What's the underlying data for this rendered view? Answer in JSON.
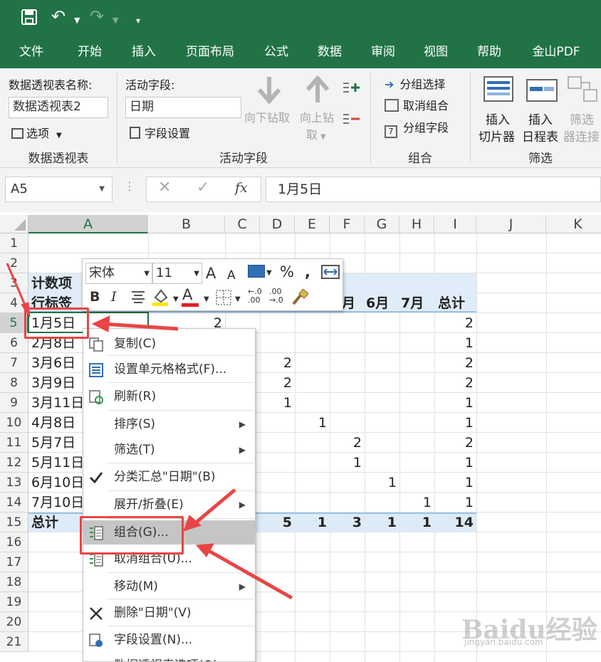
{
  "quick_access": {
    "undo_label": "↶",
    "redo_label": "↷"
  },
  "ribbon_tabs": [
    "文件",
    "开始",
    "插入",
    "页面布局",
    "公式",
    "数据",
    "审阅",
    "视图",
    "帮助",
    "金山PDF"
  ],
  "ribbon": {
    "pivot_name_label": "数据透视表名称:",
    "pivot_name_value": "数据透视表2",
    "options_label": "选项",
    "group1_title": "数据透视表",
    "active_field_label": "活动字段:",
    "active_field_value": "日期",
    "field_settings_label": "字段设置",
    "drill_down_label": "向下钻取",
    "drill_up_label1": "向上钻",
    "drill_up_label2": "取",
    "group2_title": "活动字段",
    "group_selection_label": "分组选择",
    "ungroup_label": "取消组合",
    "group_field_label": "分组字段",
    "group3_title": "组合",
    "insert_slicer_1": "插入",
    "insert_slicer_2": "切片器",
    "insert_timeline_1": "插入",
    "insert_timeline_2": "日程表",
    "filter_conn_1": "筛选",
    "filter_conn_2": "器连接",
    "group4_title": "筛选"
  },
  "formula_bar": {
    "name_box": "A5",
    "fx": "fx",
    "value": "1月5日"
  },
  "columns": [
    "A",
    "B",
    "C",
    "D",
    "E",
    "F",
    "G",
    "H",
    "I",
    "J",
    "K"
  ],
  "rows": [
    "1",
    "2",
    "3",
    "4",
    "5",
    "6",
    "7",
    "8",
    "9",
    "10",
    "11",
    "12",
    "13",
    "14",
    "15",
    "16",
    "17",
    "18",
    "19",
    "20",
    "21"
  ],
  "pivot": {
    "title": "计数项",
    "row_label": "行标签",
    "col_headers_visible": [
      "月",
      "6月",
      "7月",
      "总计"
    ],
    "row_labels": [
      "1月5日",
      "2月8日",
      "3月6日",
      "3月9日",
      "3月11日",
      "4月8日",
      "5月7日",
      "5月11日",
      "6月10日",
      "7月10日"
    ],
    "total_label": "总计",
    "b_values": [
      "2",
      "",
      "",
      "",
      "",
      "",
      "",
      "",
      "",
      ""
    ],
    "d_values": [
      "",
      "",
      "2",
      "2",
      "1",
      "",
      "",
      "",
      "",
      ""
    ],
    "e_values": [
      "",
      "",
      "",
      "",
      "",
      "1",
      "",
      "",
      "",
      ""
    ],
    "f_values": [
      "",
      "",
      "",
      "",
      "",
      "",
      "2",
      "1",
      "",
      ""
    ],
    "g_values": [
      "",
      "",
      "",
      "",
      "",
      "",
      "",
      "",
      "1",
      ""
    ],
    "h_values": [
      "",
      "",
      "",
      "",
      "",
      "",
      "",
      "",
      "",
      "1"
    ],
    "i_values": [
      "2",
      "1",
      "2",
      "2",
      "1",
      "1",
      "2",
      "1",
      "1",
      "1"
    ],
    "totals": {
      "D": "5",
      "E": "1",
      "F": "3",
      "G": "1",
      "H": "1",
      "I": "14"
    }
  },
  "mini_toolbar": {
    "font": "宋体",
    "size": "11",
    "grow": "A",
    "shrink": "A",
    "percent": "%",
    "comma": ",",
    "bold": "B",
    "italic": "I",
    "inc_dec": ".00",
    "dec_dec": ".0"
  },
  "context_menu": [
    {
      "label": "复制(C)",
      "icon": "copy-icon"
    },
    {
      "label": "设置单元格格式(F)...",
      "icon": "format-cells-icon"
    },
    {
      "label": "刷新(R)",
      "icon": "refresh-icon"
    },
    {
      "label": "排序(S)",
      "icon": ""
    },
    {
      "label": "筛选(T)",
      "icon": ""
    },
    {
      "label": "分类汇总\"日期\"(B)",
      "icon": "check-icon"
    },
    {
      "label": "展开/折叠(E)",
      "icon": ""
    },
    {
      "label": "组合(G)...",
      "icon": "group-icon"
    },
    {
      "label": "取消组合(U)...",
      "icon": "ungroup-icon"
    },
    {
      "label": "移动(M)",
      "icon": ""
    },
    {
      "label": "删除\"日期\"(V)",
      "icon": "delete-icon"
    },
    {
      "label": "字段设置(N)...",
      "icon": "field-settings-icon"
    },
    {
      "label": "数据透视表选项(O)...",
      "icon": ""
    }
  ],
  "watermark": {
    "main": "Baidu经验",
    "sub": "jingyan.baidu.com"
  },
  "colors": {
    "excel_green": "#217346",
    "highlight_red": "#e84545",
    "pivot_header": "#ddebf7"
  }
}
